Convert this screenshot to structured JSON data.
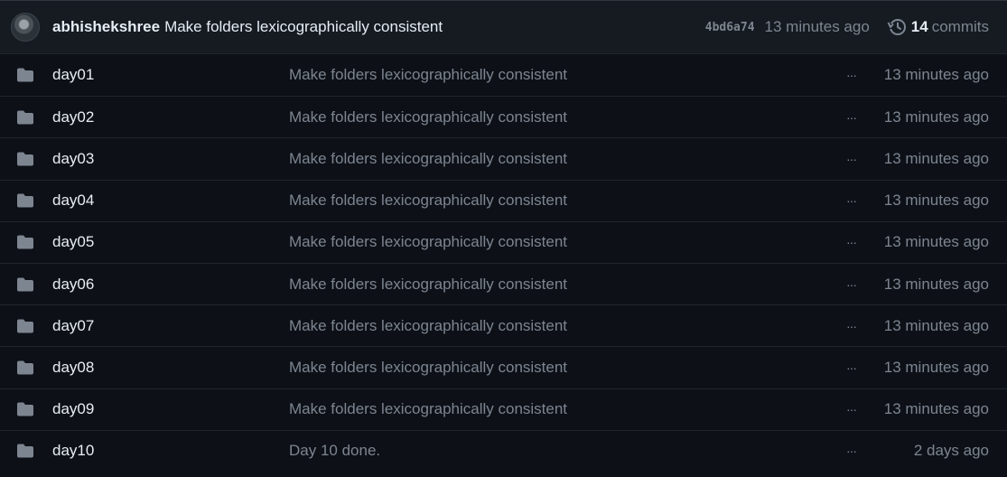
{
  "latest_commit": {
    "author": "abhishekshree",
    "message": "Make folders lexicographically consistent",
    "sha": "4bd6a74",
    "time": "13 minutes ago",
    "commit_count": "14",
    "commit_word": "commits"
  },
  "files": [
    {
      "name": "day01",
      "message": "Make folders lexicographically consistent",
      "time": "13 minutes ago"
    },
    {
      "name": "day02",
      "message": "Make folders lexicographically consistent",
      "time": "13 minutes ago"
    },
    {
      "name": "day03",
      "message": "Make folders lexicographically consistent",
      "time": "13 minutes ago"
    },
    {
      "name": "day04",
      "message": "Make folders lexicographically consistent",
      "time": "13 minutes ago"
    },
    {
      "name": "day05",
      "message": "Make folders lexicographically consistent",
      "time": "13 minutes ago"
    },
    {
      "name": "day06",
      "message": "Make folders lexicographically consistent",
      "time": "13 minutes ago"
    },
    {
      "name": "day07",
      "message": "Make folders lexicographically consistent",
      "time": "13 minutes ago"
    },
    {
      "name": "day08",
      "message": "Make folders lexicographically consistent",
      "time": "13 minutes ago"
    },
    {
      "name": "day09",
      "message": "Make folders lexicographically consistent",
      "time": "13 minutes ago"
    },
    {
      "name": "day10",
      "message": "Day 10 done.",
      "time": "2 days ago"
    }
  ],
  "ellipsis": "···",
  "icons": {
    "avatar": "avatar",
    "history": "history-icon",
    "folder": "folder-icon"
  },
  "colors": {
    "background": "#0d1117",
    "header_background": "#161b22",
    "muted_text": "#7d8590",
    "primary_text": "#e6edf3",
    "folder_icon": "#7d8590"
  }
}
